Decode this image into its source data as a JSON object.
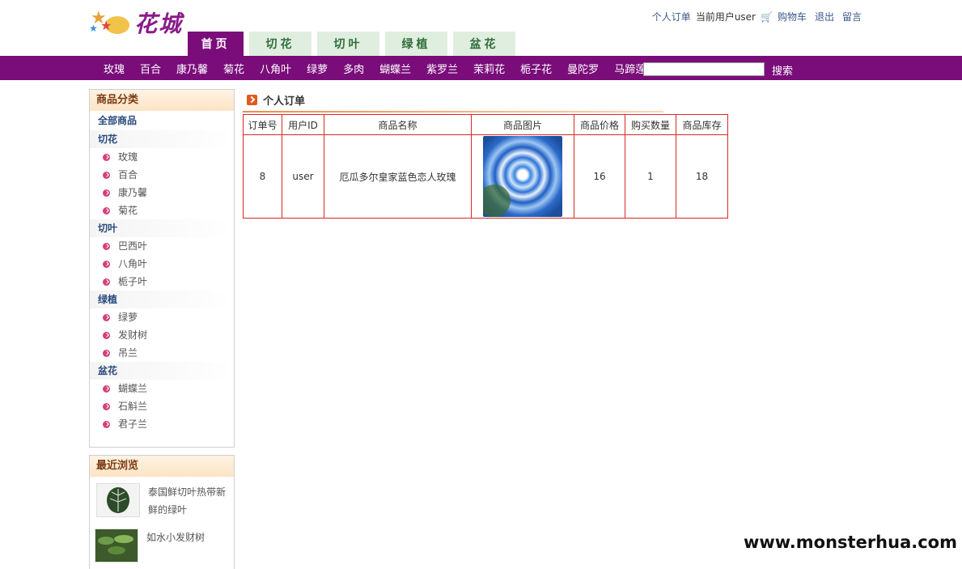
{
  "logo": {
    "text": "花城"
  },
  "toplinks": {
    "my_orders": "个人订单",
    "current_user": "当前用户user",
    "cart": "购物车",
    "logout": "退出",
    "message": "留言"
  },
  "tabs": [
    {
      "label": "首页",
      "active": true
    },
    {
      "label": "切花",
      "active": false
    },
    {
      "label": "切叶",
      "active": false
    },
    {
      "label": "绿植",
      "active": false
    },
    {
      "label": "盆花",
      "active": false
    }
  ],
  "nav": {
    "items": [
      "玫瑰",
      "百合",
      "康乃馨",
      "菊花",
      "八角叶",
      "绿萝",
      "多肉",
      "蝴蝶兰",
      "紫罗兰",
      "茉莉花",
      "栀子花",
      "曼陀罗",
      "马蹄莲"
    ],
    "search_value": "",
    "search_button": "搜索"
  },
  "sidebar": {
    "header": "商品分类",
    "all": "全部商品",
    "categories": [
      {
        "name": "切花",
        "items": [
          "玫瑰",
          "百合",
          "康乃馨",
          "菊花"
        ]
      },
      {
        "name": "切叶",
        "items": [
          "巴西叶",
          "八角叶",
          "栀子叶"
        ]
      },
      {
        "name": "绿植",
        "items": [
          "绿萝",
          "发财树",
          "吊兰"
        ]
      },
      {
        "name": "盆花",
        "items": [
          "蝴蝶兰",
          "石斛兰",
          "君子兰"
        ]
      }
    ]
  },
  "recent": {
    "header": "最近浏览",
    "items": [
      {
        "name": "泰国鲜切叶热带新鲜的绿叶"
      },
      {
        "name": "如水小发财树"
      }
    ]
  },
  "main": {
    "title": "个人订单",
    "columns": [
      "订单号",
      "用户ID",
      "商品名称",
      "商品图片",
      "商品价格",
      "购买数量",
      "商品库存"
    ],
    "rows": [
      {
        "order_id": "8",
        "user_id": "user",
        "product_name": "厄瓜多尔皇家蓝色恋人玫瑰",
        "price": "16",
        "quantity": "1",
        "stock": "18"
      }
    ]
  },
  "watermark": "www.monsterhua.com",
  "colors": {
    "brand_purple": "#7a0d7a",
    "table_border": "#d62828",
    "tab_green_bg": "#e0eedf"
  }
}
